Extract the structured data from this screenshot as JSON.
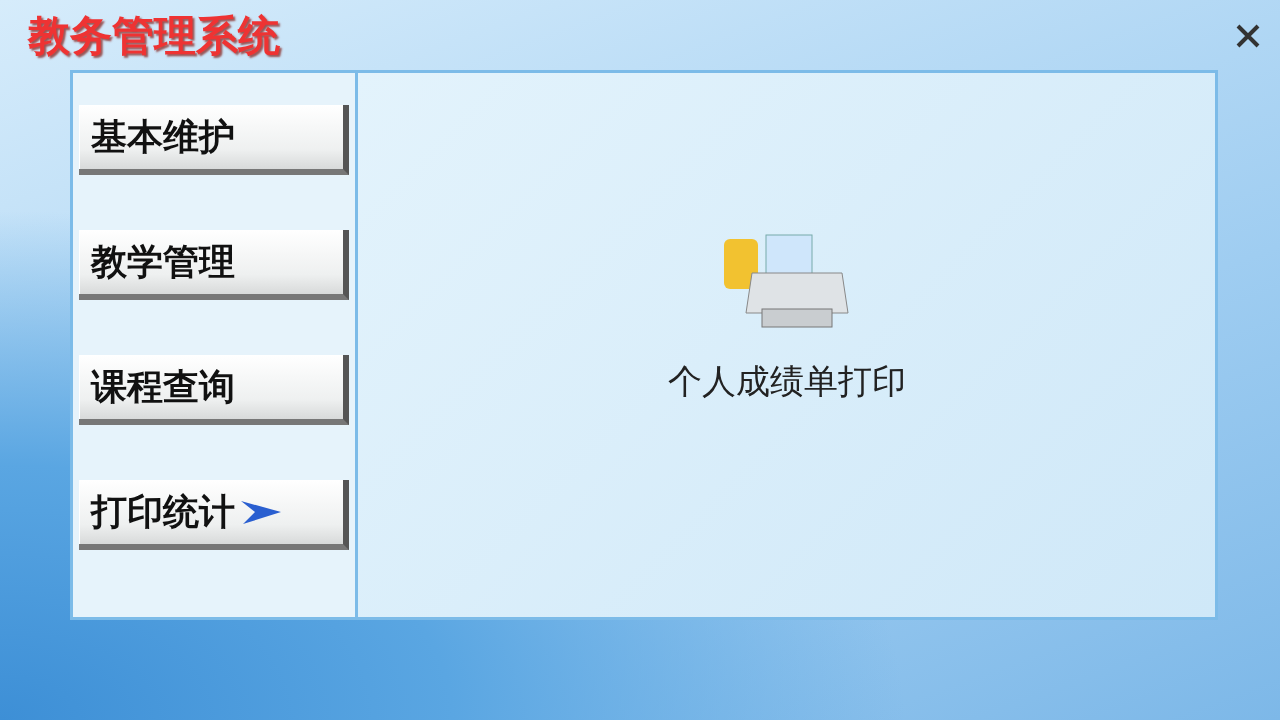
{
  "window": {
    "title": "教务管理系统"
  },
  "menu": [
    {
      "label": "基本维护",
      "selected": false
    },
    {
      "label": "教学管理",
      "selected": false
    },
    {
      "label": "课程查询",
      "selected": false
    },
    {
      "label": "打印统计",
      "selected": true
    }
  ],
  "content": {
    "items": [
      {
        "label": "个人成绩单打印"
      }
    ]
  }
}
